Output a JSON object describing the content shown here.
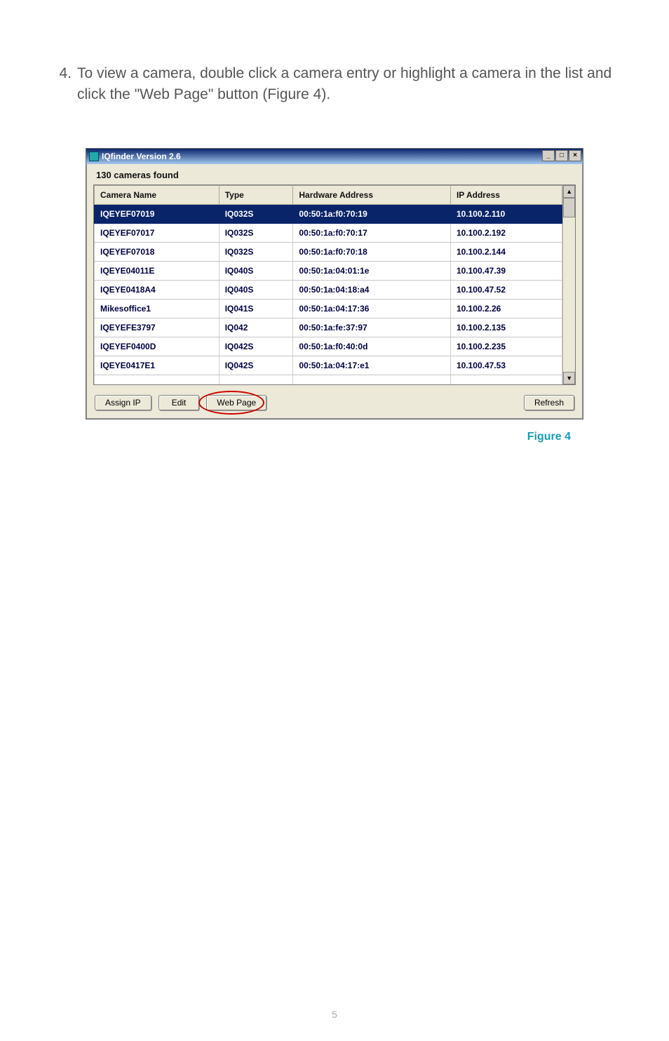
{
  "instruction": {
    "number": "4.",
    "text": "To view a camera, double click a camera entry or highlight a camera in the list and click the \"Web Page\" button (Figure 4)."
  },
  "window": {
    "title": "IQfinder Version 2.6",
    "status": "130 cameras found",
    "columns": [
      "Camera Name",
      "Type",
      "Hardware Address",
      "IP Address"
    ],
    "rows": [
      {
        "name": "IQEYEF07019",
        "type": "IQ032S",
        "hw": "00:50:1a:f0:70:19",
        "ip": "10.100.2.110",
        "selected": true
      },
      {
        "name": "IQEYEF07017",
        "type": "IQ032S",
        "hw": "00:50:1a:f0:70:17",
        "ip": "10.100.2.192",
        "selected": false
      },
      {
        "name": "IQEYEF07018",
        "type": "IQ032S",
        "hw": "00:50:1a:f0:70:18",
        "ip": "10.100.2.144",
        "selected": false
      },
      {
        "name": "IQEYE04011E",
        "type": "IQ040S",
        "hw": "00:50:1a:04:01:1e",
        "ip": "10.100.47.39",
        "selected": false
      },
      {
        "name": "IQEYE0418A4",
        "type": "IQ040S",
        "hw": "00:50:1a:04:18:a4",
        "ip": "10.100.47.52",
        "selected": false
      },
      {
        "name": "Mikesoffice1",
        "type": "IQ041S",
        "hw": "00:50:1a:04:17:36",
        "ip": "10.100.2.26",
        "selected": false
      },
      {
        "name": "IQEYEFE3797",
        "type": "IQ042",
        "hw": "00:50:1a:fe:37:97",
        "ip": "10.100.2.135",
        "selected": false
      },
      {
        "name": "IQEYEF0400D",
        "type": "IQ042S",
        "hw": "00:50:1a:f0:40:0d",
        "ip": "10.100.2.235",
        "selected": false
      },
      {
        "name": "IQEYE0417E1",
        "type": "IQ042S",
        "hw": "00:50:1a:04:17:e1",
        "ip": "10.100.47.53",
        "selected": false
      }
    ],
    "partial_row": {
      "name": "",
      "type": "",
      "hw": "",
      "ip": ""
    },
    "buttons": {
      "assign_ip": "Assign IP",
      "edit": "Edit",
      "web_page": "Web Page",
      "refresh": "Refresh"
    },
    "win_controls": {
      "min": "_",
      "max": "□",
      "close": "×"
    },
    "scroll": {
      "up": "▲",
      "down": "▼"
    }
  },
  "figure_caption": "Figure 4",
  "page_number": "5"
}
